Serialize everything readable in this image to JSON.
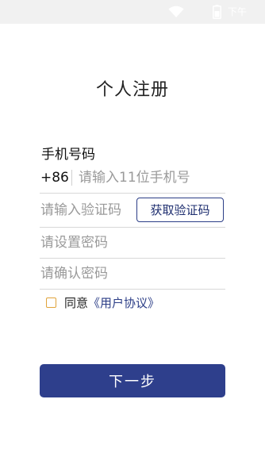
{
  "status_bar": {
    "time": "下午",
    "wifi_icon": "wifi-icon",
    "battery_icon": "battery-icon"
  },
  "title": "个人注册",
  "phone": {
    "label": "手机号码",
    "country_code": "+86",
    "placeholder": "请输入11位手机号",
    "value": ""
  },
  "verification": {
    "placeholder": "请输入验证码",
    "value": "",
    "button_label": "获取验证码"
  },
  "password": {
    "placeholder": "请设置密码",
    "value": ""
  },
  "confirm_password": {
    "placeholder": "请确认密码",
    "value": ""
  },
  "agreement": {
    "checked": false,
    "text": "同意",
    "link_text": "《用户协议》"
  },
  "next_button_label": "下一步",
  "colors": {
    "primary": "#2e3f8c",
    "checkbox_border": "#e0a33a",
    "status_bar_bg": "#f1f1f1"
  }
}
